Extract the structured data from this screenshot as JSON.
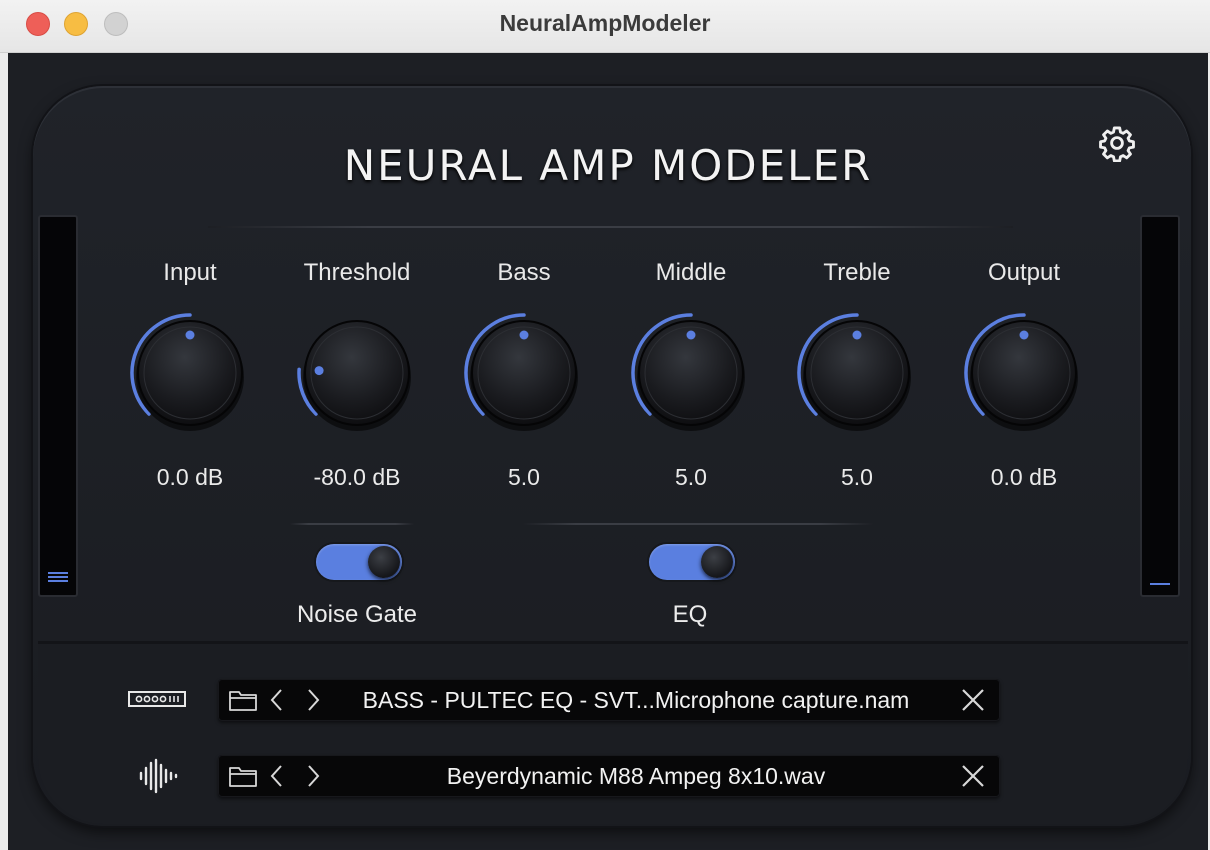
{
  "window": {
    "title": "NeuralAmpModeler"
  },
  "plugin": {
    "title": "NEURAL AMP MODELER"
  },
  "colors": {
    "accent": "#5b7fe0",
    "background": "#1d1f24",
    "text": "#ececec"
  },
  "knobs": [
    {
      "label": "Input",
      "value": "0.0 dB",
      "fraction": 0.5
    },
    {
      "label": "Threshold",
      "value": "-80.0 dB",
      "fraction": 0.18
    },
    {
      "label": "Bass",
      "value": "5.0",
      "fraction": 0.5
    },
    {
      "label": "Middle",
      "value": "5.0",
      "fraction": 0.5
    },
    {
      "label": "Treble",
      "value": "5.0",
      "fraction": 0.5
    },
    {
      "label": "Output",
      "value": "0.0 dB",
      "fraction": 0.5
    }
  ],
  "toggles": [
    {
      "label": "Noise Gate",
      "on": true
    },
    {
      "label": "EQ",
      "on": true
    }
  ],
  "model": {
    "file": "BASS - PULTEC EQ - SVT...Microphone capture.nam"
  },
  "ir": {
    "file": "Beyerdynamic M88 Ampeg 8x10.wav"
  },
  "icons": {
    "settings": "gear-icon",
    "folder": "folder-icon",
    "prev": "chevron-left-icon",
    "next": "chevron-right-icon",
    "clear": "close-icon",
    "model": "amp-model-icon",
    "ir": "waveform-icon"
  }
}
